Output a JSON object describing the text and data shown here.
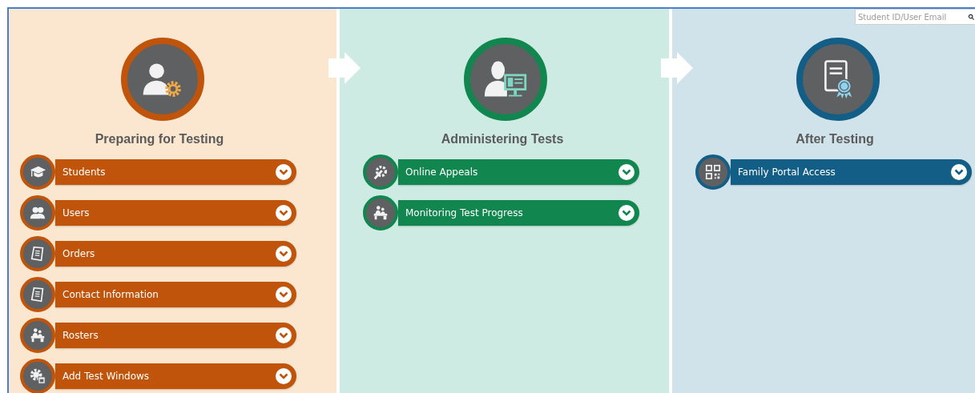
{
  "search": {
    "placeholder": "Student ID/User Email"
  },
  "columns": [
    {
      "title": "Preparing for Testing",
      "color": "#c0540a",
      "kind": "person-gear",
      "items": [
        {
          "label": "Students",
          "kind": "cap"
        },
        {
          "label": "Users",
          "kind": "people"
        },
        {
          "label": "Orders",
          "kind": "document"
        },
        {
          "label": "Contact Information",
          "kind": "document"
        },
        {
          "label": "Rosters",
          "kind": "desk"
        },
        {
          "label": "Add Test Windows",
          "kind": "gear"
        }
      ]
    },
    {
      "title": "Administering Tests",
      "color": "#11874f",
      "kind": "person-monitor",
      "items": [
        {
          "label": "Online Appeals",
          "kind": "wrench"
        },
        {
          "label": "Monitoring Test Progress",
          "kind": "desk"
        }
      ]
    },
    {
      "title": "After Testing",
      "color": "#125e86",
      "kind": "certificate",
      "items": [
        {
          "label": "Family Portal Access",
          "kind": "qr"
        }
      ]
    }
  ]
}
